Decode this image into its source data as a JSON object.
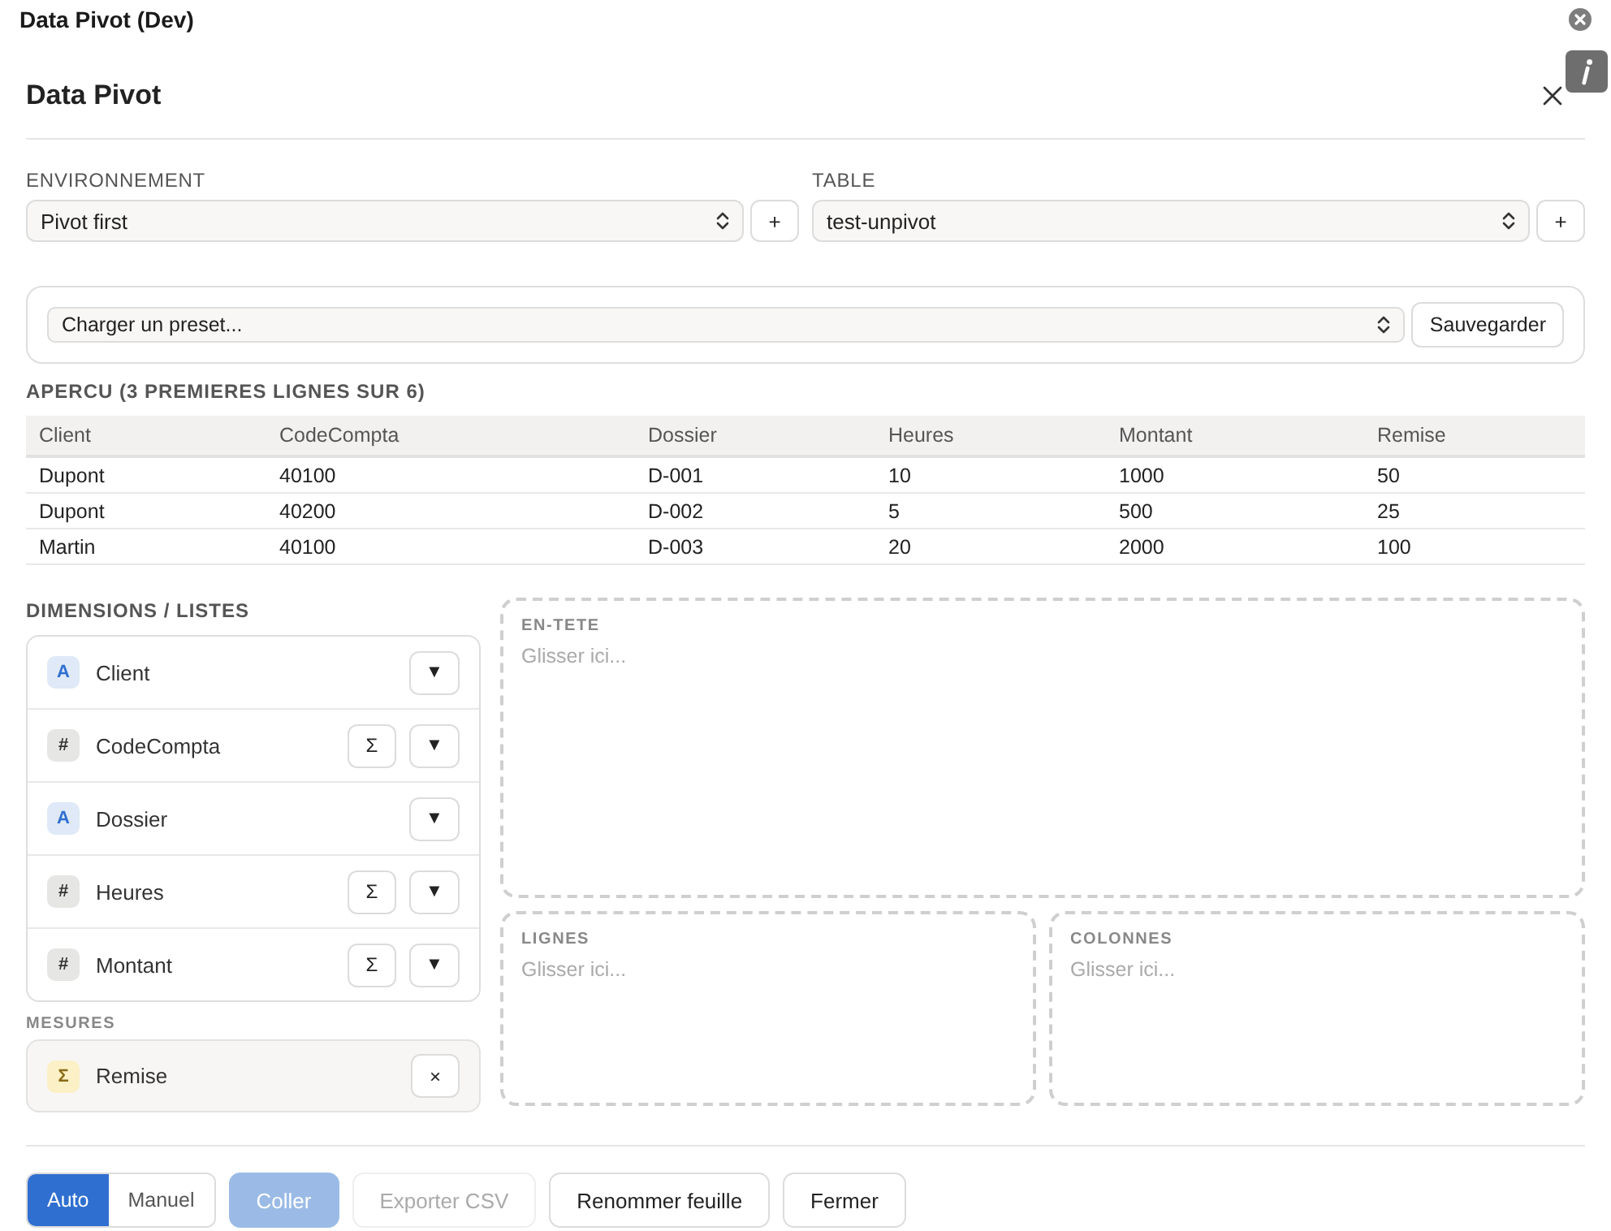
{
  "window": {
    "title": "Data Pivot (Dev)"
  },
  "dialog": {
    "title": "Data Pivot"
  },
  "pickers": [
    {
      "label": "ENVIRONNEMENT",
      "value": "Pivot first",
      "add_button": "+"
    },
    {
      "label": "TABLE",
      "value": "test-unpivot",
      "add_button": "+"
    }
  ],
  "preset": {
    "value": "Charger un preset...",
    "save_button": "Sauvegarder"
  },
  "preview": {
    "title": "APERCU (3 PREMIERES LIGNES SUR 6)",
    "columns": [
      "Client",
      "CodeCompta",
      "Dossier",
      "Heures",
      "Montant",
      "Remise"
    ],
    "rows": [
      [
        "Dupont",
        "40100",
        "D-001",
        "10",
        "1000",
        "50"
      ],
      [
        "Dupont",
        "40200",
        "D-002",
        "5",
        "500",
        "25"
      ],
      [
        "Martin",
        "40100",
        "D-003",
        "20",
        "2000",
        "100"
      ]
    ]
  },
  "dimensions": {
    "title": "DIMENSIONS / LISTES",
    "items": [
      {
        "kind": "text",
        "badge": "A",
        "name": "Client",
        "filter_button": "▼"
      },
      {
        "kind": "number",
        "badge": "#",
        "name": "CodeCompta",
        "aggregate_button": "Σ",
        "filter_button": "▼"
      },
      {
        "kind": "text",
        "badge": "A",
        "name": "Dossier",
        "filter_button": "▼"
      },
      {
        "kind": "number",
        "badge": "#",
        "name": "Heures",
        "aggregate_button": "Σ",
        "filter_button": "▼"
      },
      {
        "kind": "number",
        "badge": "#",
        "name": "Montant",
        "aggregate_button": "Σ",
        "filter_button": "▼"
      }
    ]
  },
  "measures": {
    "title": "MESURES",
    "items": [
      {
        "kind": "measure",
        "badge": "Σ",
        "name": "Remise",
        "remove_button": "×"
      }
    ]
  },
  "drop_zones": [
    {
      "label": "EN-TETE",
      "hint": "Glisser ici..."
    },
    {
      "label": "LIGNES",
      "hint": "Glisser ici..."
    },
    {
      "label": "COLONNES",
      "hint": "Glisser ici..."
    }
  ],
  "footer": {
    "mode": [
      {
        "label": "Auto",
        "selected": true
      },
      {
        "label": "Manuel",
        "selected": false
      }
    ],
    "buttons": [
      {
        "label": "Coller",
        "kind": "primary",
        "disabled": true
      },
      {
        "label": "Exporter CSV",
        "kind": "secondary",
        "disabled": true
      },
      {
        "label": "Renommer feuille",
        "kind": "secondary",
        "disabled": false
      },
      {
        "label": "Fermer",
        "kind": "secondary",
        "disabled": false
      }
    ]
  }
}
